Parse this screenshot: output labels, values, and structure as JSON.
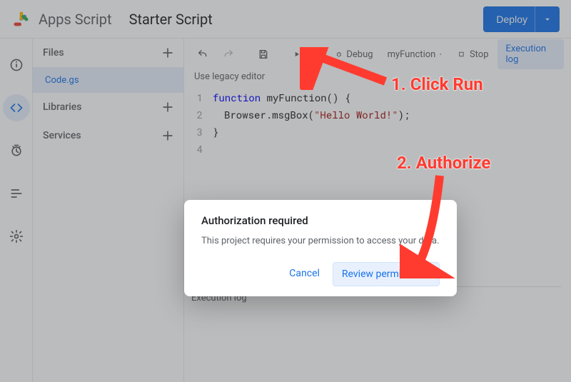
{
  "header": {
    "brand": "Apps Script",
    "project_title": "Starter Script",
    "deploy_label": "Deploy"
  },
  "leftrail": {
    "items": [
      "info",
      "editor",
      "triggers",
      "executions",
      "settings"
    ],
    "active_index": 1
  },
  "sidebar": {
    "files_label": "Files",
    "libraries_label": "Libraries",
    "services_label": "Services",
    "file_name": "Code.gs"
  },
  "toolbar": {
    "run_label": "Run",
    "debug_label": "Debug",
    "function_name": "myFunction",
    "stop_label": "Stop",
    "execution_log_label": "Execution log",
    "legacy_label": "Use legacy editor"
  },
  "code": {
    "lines": [
      "1",
      "2",
      "3",
      "4"
    ],
    "kw_function": "function",
    "fn_name": "myFunction",
    "open": "() {",
    "l2a": "Browser",
    "l2b": ".msgBox(",
    "l2_str": "\"Hello World!\"",
    "l2c": ");",
    "close": "}"
  },
  "execlog": {
    "title": "Execution log"
  },
  "dialog": {
    "title": "Authorization required",
    "body": "This project requires your permission to access your data.",
    "cancel": "Cancel",
    "confirm": "Review permissions"
  },
  "annotations": {
    "step1": "1. Click Run",
    "step2": "2. Authorize"
  }
}
